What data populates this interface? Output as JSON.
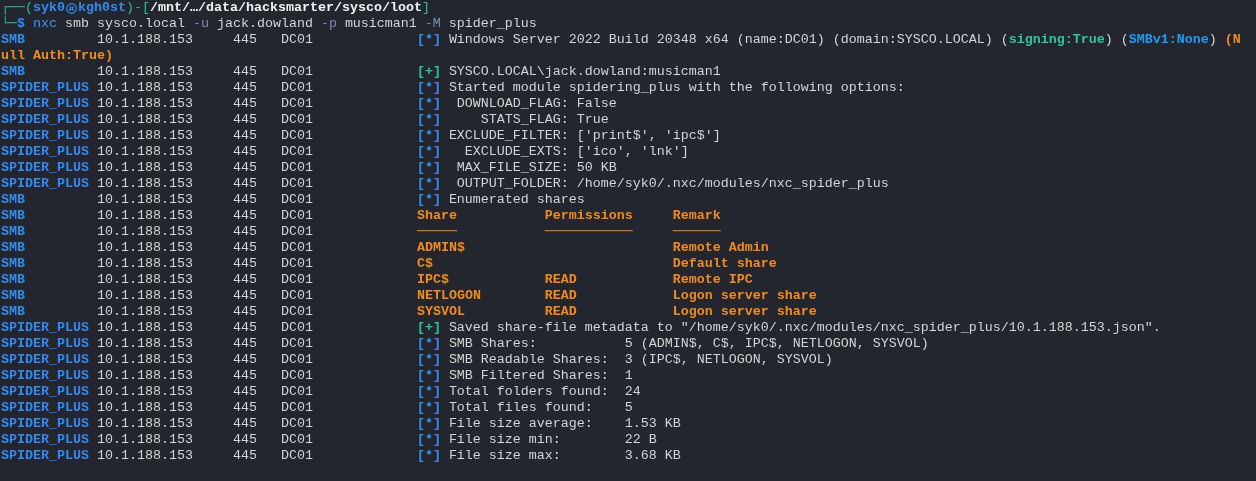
{
  "prompt": {
    "user": "syk0",
    "host": "kgh0st",
    "top_parts": [
      {
        "text": "┌──(",
        "kind": "frame"
      },
      {
        "kind": "identity"
      },
      {
        "text": ")-[",
        "kind": "frame"
      },
      {
        "text": "/mnt/…/data/hacksmarter/sysco/loot",
        "kind": "path"
      },
      {
        "text": "]",
        "kind": "frame"
      }
    ],
    "command_parts": [
      {
        "text": "└─",
        "kind": "frame"
      },
      {
        "text": "$",
        "kind": "sign"
      },
      {
        "text": "nxc",
        "kind": "program"
      },
      {
        "text": "smb sysco.local",
        "kind": "arg"
      },
      {
        "text": "-u",
        "kind": "flag"
      },
      {
        "text": "jack.dowland",
        "kind": "arg"
      },
      {
        "text": "-p",
        "kind": "flag"
      },
      {
        "text": "musicman1",
        "kind": "arg"
      },
      {
        "text": "-M",
        "kind": "flag"
      },
      {
        "text": "spider_plus",
        "kind": "arg"
      }
    ]
  },
  "lines": [
    {
      "kind": "message",
      "protocol": "SMB",
      "ip": "10.1.188.153",
      "port": "445",
      "host": "DC01",
      "marker": "[*]",
      "success": false,
      "parts": [
        {
          "text": "Windows Server 2022 Build 20348 x64 (name:DC01) (domain:SYSCO.LOCAL) (",
          "color": "#d4d4d4"
        },
        {
          "text": "signing:True",
          "color": "#2ec4a0"
        },
        {
          "text": ") (",
          "color": "#d4d4d4"
        },
        {
          "text": "SMBv1:None",
          "color": "#1c9cf5"
        },
        {
          "text": ") ",
          "color": "#d4d4d4"
        },
        {
          "text": "(N",
          "color": "#f28c1b"
        }
      ]
    },
    {
      "kind": "wrap",
      "parts": [
        {
          "text": "ull Auth:True)",
          "color": "#f28c1b"
        }
      ]
    },
    {
      "kind": "message",
      "protocol": "SMB",
      "ip": "10.1.188.153",
      "port": "445",
      "host": "DC01",
      "marker": "[+]",
      "success": true,
      "parts": [
        {
          "text": "SYSCO.LOCAL\\jack.dowland:musicman1",
          "color": "#d4d4d4"
        }
      ]
    },
    {
      "kind": "message",
      "protocol": "SPIDER_PLUS",
      "ip": "10.1.188.153",
      "port": "445",
      "host": "DC01",
      "marker": "[*]",
      "success": false,
      "parts": [
        {
          "text": "Started module spidering_plus with the following options:",
          "color": "#d4d4d4"
        }
      ]
    },
    {
      "kind": "option",
      "protocol": "SPIDER_PLUS",
      "ip": "10.1.188.153",
      "port": "445",
      "host": "DC01",
      "marker": "[*]",
      "success": false,
      "key": "DOWNLOAD_FLAG:",
      "value": "False"
    },
    {
      "kind": "option",
      "protocol": "SPIDER_PLUS",
      "ip": "10.1.188.153",
      "port": "445",
      "host": "DC01",
      "marker": "[*]",
      "success": false,
      "key": "STATS_FLAG:",
      "value": "True"
    },
    {
      "kind": "option",
      "protocol": "SPIDER_PLUS",
      "ip": "10.1.188.153",
      "port": "445",
      "host": "DC01",
      "marker": "[*]",
      "success": false,
      "key": "EXCLUDE_FILTER:",
      "value": "['print$', 'ipc$']"
    },
    {
      "kind": "option",
      "protocol": "SPIDER_PLUS",
      "ip": "10.1.188.153",
      "port": "445",
      "host": "DC01",
      "marker": "[*]",
      "success": false,
      "key": "EXCLUDE_EXTS:",
      "value": "['ico', 'lnk']"
    },
    {
      "kind": "option",
      "protocol": "SPIDER_PLUS",
      "ip": "10.1.188.153",
      "port": "445",
      "host": "DC01",
      "marker": "[*]",
      "success": false,
      "key": "MAX_FILE_SIZE:",
      "value": "50 KB"
    },
    {
      "kind": "option",
      "protocol": "SPIDER_PLUS",
      "ip": "10.1.188.153",
      "port": "445",
      "host": "DC01",
      "marker": "[*]",
      "success": false,
      "key": "OUTPUT_FOLDER:",
      "value": "/home/syk0/.nxc/modules/nxc_spider_plus"
    },
    {
      "kind": "message",
      "protocol": "SMB",
      "ip": "10.1.188.153",
      "port": "445",
      "host": "DC01",
      "marker": "[*]",
      "success": false,
      "parts": [
        {
          "text": "Enumerated shares",
          "color": "#d4d4d4"
        }
      ]
    },
    {
      "kind": "table_header",
      "protocol": "SMB",
      "ip": "10.1.188.153",
      "port": "445",
      "host": "DC01",
      "cells": [
        "Share",
        "Permissions",
        "Remark"
      ]
    },
    {
      "kind": "table_rule",
      "protocol": "SMB",
      "ip": "10.1.188.153",
      "port": "445",
      "host": "DC01",
      "cells": [
        "─────",
        "───────────",
        "──────"
      ]
    },
    {
      "kind": "table_row",
      "protocol": "SMB",
      "ip": "10.1.188.153",
      "port": "445",
      "host": "DC01",
      "share": "ADMIN$",
      "remark": "Remote Admin"
    },
    {
      "kind": "table_row",
      "protocol": "SMB",
      "ip": "10.1.188.153",
      "port": "445",
      "host": "DC01",
      "share": "C$",
      "remark": "Default share"
    },
    {
      "kind": "table_row",
      "protocol": "SMB",
      "ip": "10.1.188.153",
      "port": "445",
      "host": "DC01",
      "share": "IPC$",
      "permissions": "READ",
      "remark": "Remote IPC"
    },
    {
      "kind": "table_row",
      "protocol": "SMB",
      "ip": "10.1.188.153",
      "port": "445",
      "host": "DC01",
      "share": "NETLOGON",
      "permissions": "READ",
      "remark": "Logon server share"
    },
    {
      "kind": "table_row",
      "protocol": "SMB",
      "ip": "10.1.188.153",
      "port": "445",
      "host": "DC01",
      "share": "SYSVOL",
      "permissions": "READ",
      "remark": "Logon server share"
    },
    {
      "kind": "message",
      "protocol": "SPIDER_PLUS",
      "ip": "10.1.188.153",
      "port": "445",
      "host": "DC01",
      "marker": "[+]",
      "success": true,
      "parts": [
        {
          "text": "Saved share-file metadata to \"/home/syk0/.nxc/modules/nxc_spider_plus/10.1.188.153.json\".",
          "color": "#d4d4d4"
        }
      ]
    },
    {
      "kind": "stat",
      "protocol": "SPIDER_PLUS",
      "ip": "10.1.188.153",
      "port": "445",
      "host": "DC01",
      "marker": "[*]",
      "success": false,
      "label": "SMB Shares:",
      "value": "5 (ADMIN$, C$, IPC$, NETLOGON, SYSVOL)"
    },
    {
      "kind": "stat",
      "protocol": "SPIDER_PLUS",
      "ip": "10.1.188.153",
      "port": "445",
      "host": "DC01",
      "marker": "[*]",
      "success": false,
      "label": "SMB Readable Shares:",
      "value": "3 (IPC$, NETLOGON, SYSVOL)"
    },
    {
      "kind": "stat",
      "protocol": "SPIDER_PLUS",
      "ip": "10.1.188.153",
      "port": "445",
      "host": "DC01",
      "marker": "[*]",
      "success": false,
      "label": "SMB Filtered Shares:",
      "value": "1"
    },
    {
      "kind": "stat",
      "protocol": "SPIDER_PLUS",
      "ip": "10.1.188.153",
      "port": "445",
      "host": "DC01",
      "marker": "[*]",
      "success": false,
      "label": "Total folders found:",
      "value": "24"
    },
    {
      "kind": "stat",
      "protocol": "SPIDER_PLUS",
      "ip": "10.1.188.153",
      "port": "445",
      "host": "DC01",
      "marker": "[*]",
      "success": false,
      "label": "Total files found:",
      "value": "5"
    },
    {
      "kind": "stat",
      "protocol": "SPIDER_PLUS",
      "ip": "10.1.188.153",
      "port": "445",
      "host": "DC01",
      "marker": "[*]",
      "success": false,
      "label": "File size average:",
      "value": "1.53 KB"
    },
    {
      "kind": "stat",
      "protocol": "SPIDER_PLUS",
      "ip": "10.1.188.153",
      "port": "445",
      "host": "DC01",
      "marker": "[*]",
      "success": false,
      "label": "File size min:",
      "value": "22 B"
    },
    {
      "kind": "stat",
      "protocol": "SPIDER_PLUS",
      "ip": "10.1.188.153",
      "port": "445",
      "host": "DC01",
      "marker": "[*]",
      "success": false,
      "label": "File size max:",
      "value": "3.68 KB"
    }
  ]
}
